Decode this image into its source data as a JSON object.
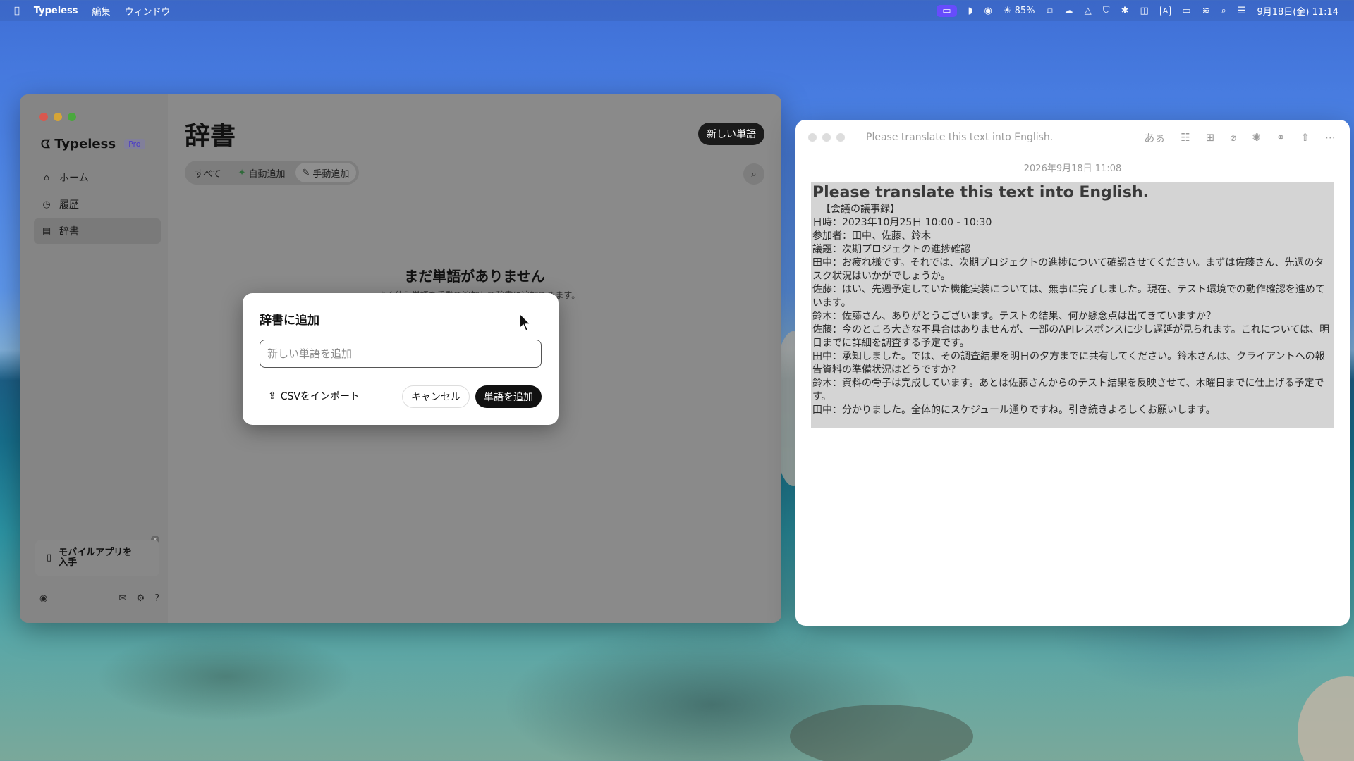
{
  "menubar": {
    "app_name": "Typeless",
    "menus": [
      "編集",
      "ウィンドウ"
    ],
    "battery_text": "85%",
    "clock": "9月18日(金)  11:14",
    "input_source": "A"
  },
  "typeless": {
    "brand": "Typeless",
    "badge": "Pro",
    "nav": [
      {
        "label": "ホーム",
        "icon": "home-icon"
      },
      {
        "label": "履歴",
        "icon": "clock-icon"
      },
      {
        "label": "辞書",
        "icon": "book-icon"
      }
    ],
    "page_title": "辞書",
    "new_word_button": "新しい単語",
    "tabs": {
      "all": "すべて",
      "auto": "自動追加",
      "manual": "手動追加"
    },
    "empty_title": "まだ単語がありません",
    "empty_sub": "…よく使う単語を手動で追加して辞書に追加できます。",
    "mobile_card": "モバイルアプリを入手"
  },
  "dialog": {
    "title": "辞書に追加",
    "input_placeholder": "新しい単語を追加",
    "import_label": "CSVをインポート",
    "cancel_label": "キャンセル",
    "add_label": "単語を追加"
  },
  "notes": {
    "window_title": "Please translate this text into English.",
    "tools": {
      "format": "あぁ"
    },
    "date": "2026年9月18日 11:08",
    "heading": "Please translate this text into English.",
    "lines": [
      "【会議の議事録】",
      "日時：2023年10月25日 10:00 - 10:30",
      "参加者：田中、佐藤、鈴木",
      "議題：次期プロジェクトの進捗確認",
      "田中：お疲れ様です。それでは、次期プロジェクトの進捗について確認させてください。まずは佐藤さん、先週のタスク状況はいかがでしょうか。",
      "佐藤：はい、先週予定していた機能実装については、無事に完了しました。現在、テスト環境での動作確認を進めています。",
      "鈴木：佐藤さん、ありがとうございます。テストの結果、何か懸念点は出てきていますか？",
      "佐藤：今のところ大きな不具合はありませんが、一部のAPIレスポンスに少し遅延が見られます。これについては、明日までに詳細を調査する予定です。",
      "田中：承知しました。では、その調査結果を明日の夕方までに共有してください。鈴木さんは、クライアントへの報告資料の準備状況はどうですか？",
      "鈴木：資料の骨子は完成しています。あとは佐藤さんからのテスト結果を反映させて、木曜日までに仕上げる予定です。",
      "田中：分かりました。全体的にスケジュール通りですね。引き続きよろしくお願いします。"
    ]
  }
}
